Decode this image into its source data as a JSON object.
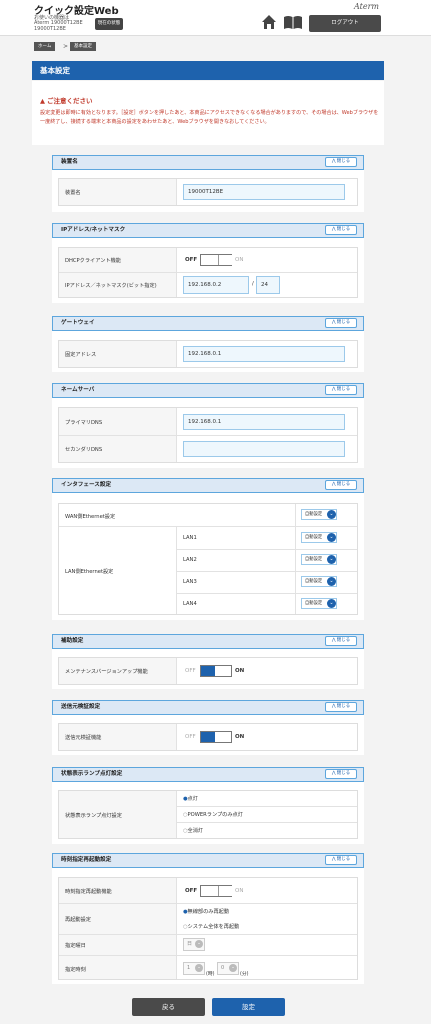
{
  "header": {
    "app_title": "クイック設定Web",
    "device_lines": [
      "お使いの機器は",
      "Aterm 19000T12BE",
      "19000T12BE"
    ],
    "status_button": "現在の状態",
    "brand": "Aterm",
    "logout_button": "ログアウト"
  },
  "breadcrumb": [
    "ホーム",
    "基本設定"
  ],
  "page_title": "基本設定",
  "notice": {
    "title": "ご注意ください",
    "text": "設定変更は即時に有効となります。［設定］ボタンを押したあと、本商品にアクセスできなくなる場合がありますので、その場合は、Webブラウザを一度終了し、接続する端末と本商品の設定をあわせたあと、Webブラウザを開きなおしてください。"
  },
  "close_label": "閉じる",
  "sections": {
    "device_name": {
      "title": "装置名",
      "label": "装置名",
      "value": "19000T12BE"
    },
    "ip": {
      "title": "IPアドレス/ネットマスク",
      "dhcp_label": "DHCPクライアント機能",
      "dhcp_off": "OFF",
      "dhcp_on": "ON",
      "ip_label": "IPアドレス／ネットマスク(ビット指定)",
      "ip_value": "192.168.0.2",
      "mask_sep": "/",
      "mask_value": "24"
    },
    "gateway": {
      "title": "ゲートウェイ",
      "label": "固定アドレス",
      "value": "192.168.0.1"
    },
    "dns": {
      "title": "ネームサーバ",
      "primary_label": "プライマリDNS",
      "primary_value": "192.168.0.1",
      "secondary_label": "セカンダリDNS",
      "secondary_value": ""
    },
    "interface": {
      "title": "インタフェース設定",
      "wan_label": "WAN側Ethernet設定",
      "lan_label": "LAN側Ethernet設定",
      "auto_label": "自動設定",
      "lan_ports": [
        "LAN1",
        "LAN2",
        "LAN3",
        "LAN4"
      ]
    },
    "aux": {
      "title": "補助設定",
      "label": "メンテナンスバージョンアップ機能",
      "off": "OFF",
      "on": "ON"
    },
    "source_check": {
      "title": "送信元検証設定",
      "label": "送信元検証機能",
      "off": "OFF",
      "on": "ON"
    },
    "lamp": {
      "title": "状態表示ランプ点灯設定",
      "label": "状態表示ランプ点灯設定",
      "options": [
        "点灯",
        "POWERランプのみ点灯",
        "全消灯"
      ],
      "selected": 0
    },
    "reboot": {
      "title": "時刻指定再起動設定",
      "func_label": "時刻指定再起動機能",
      "off": "OFF",
      "on": "ON",
      "mode_label": "再起動設定",
      "mode_options": [
        "無線部のみ再起動",
        "システム全体を再起動"
      ],
      "mode_selected": 0,
      "day_label": "指定曜日",
      "day_value": "日",
      "time_label": "指定時刻",
      "hour_value": "1",
      "hour_unit": "(時)",
      "min_value": "0",
      "min_unit": "(分)"
    }
  },
  "footer": {
    "back_button": "戻る",
    "submit_button": "設定"
  },
  "colors": {
    "primary": "#1e62ad",
    "accent_border": "#5da6dd",
    "warning": "#c0392b",
    "dark_button": "#4a4a4a"
  }
}
